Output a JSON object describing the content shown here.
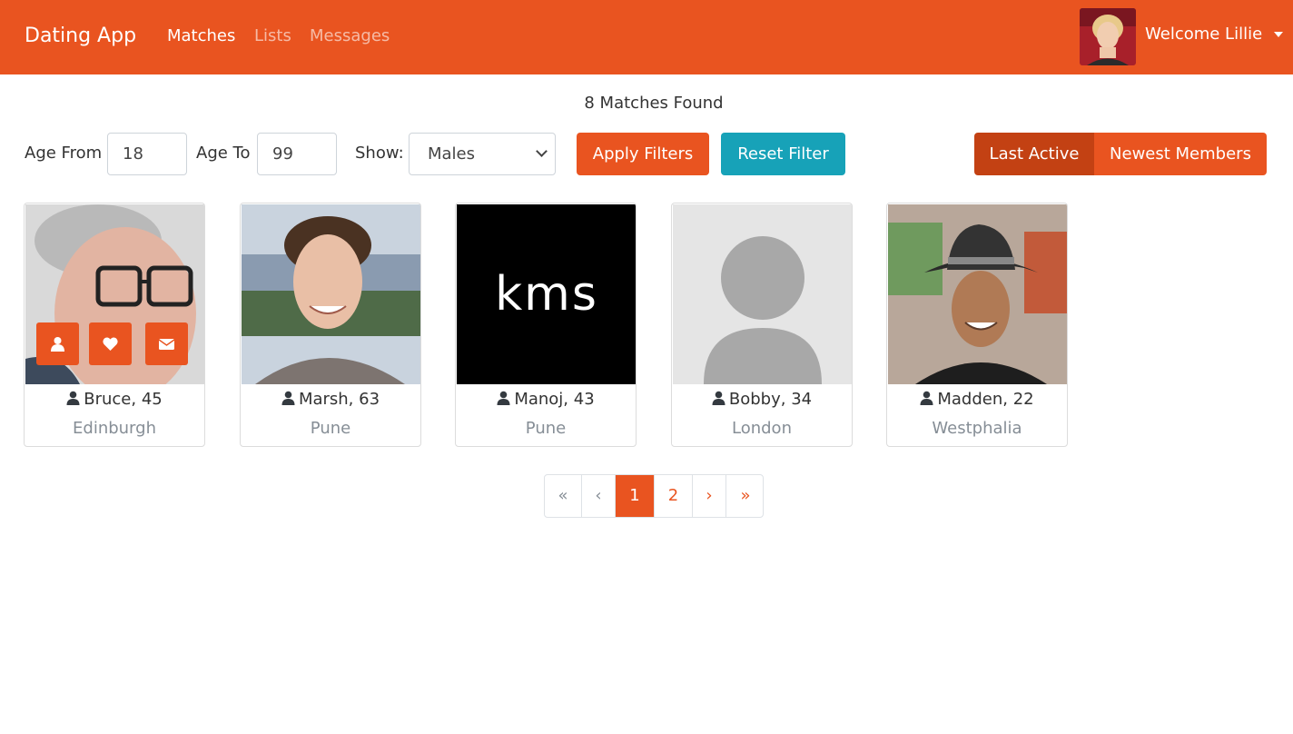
{
  "navbar": {
    "brand": "Dating App",
    "links": [
      "Matches",
      "Lists",
      "Messages"
    ],
    "welcome": "Welcome Lillie",
    "brand_color": "#e95420"
  },
  "header": {
    "matches_found": "8 Matches Found"
  },
  "filters": {
    "age_from_label": "Age From",
    "age_from_value": "18",
    "age_to_label": "Age To",
    "age_to_value": "99",
    "show_label": "Show:",
    "show_value": "Males",
    "apply_label": "Apply Filters",
    "reset_label": "Reset Filter",
    "sort_last_active": "Last Active",
    "sort_newest": "Newest Members"
  },
  "members": [
    {
      "name": "Bruce, 45",
      "city": "Edinburgh"
    },
    {
      "name": "Marsh, 63",
      "city": "Pune"
    },
    {
      "name": "Manoj, 43",
      "city": "Pune",
      "photo_text": "kms"
    },
    {
      "name": "Bobby, 34",
      "city": "London"
    },
    {
      "name": "Madden, 22",
      "city": "Westphalia"
    }
  ],
  "card_actions": [
    "user-icon",
    "heart-icon",
    "envelope-icon"
  ],
  "pagination": {
    "first": "«",
    "prev": "‹",
    "pages": [
      "1",
      "2"
    ],
    "current_page": "1",
    "next": "›",
    "last": "»"
  },
  "colors": {
    "primary": "#e95420",
    "info": "#17a2b8",
    "active_sort": "#c34113"
  }
}
